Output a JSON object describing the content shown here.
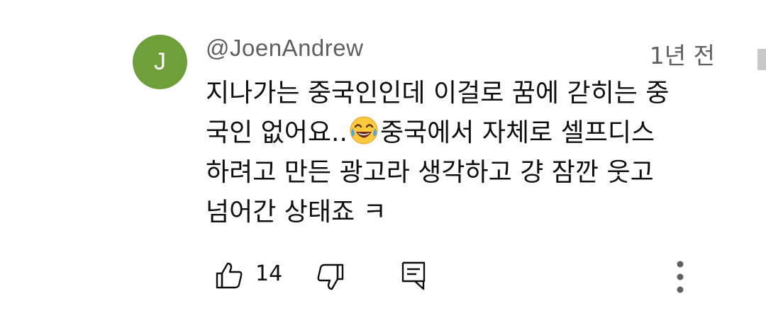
{
  "comment": {
    "avatar_letter": "J",
    "author": "@JoenAndrew",
    "time": "1년 전",
    "lines": [
      "지나가는 중국인인데 이걸로 꿈에 갇히는 중",
      "국인 없어요..",
      "중국에서 자체로 셀프디스",
      "하려고 만든 광고라 생각하고 걍 잠깐 웃고",
      "넘어간 상태죠 ㅋ"
    ],
    "emoji": "face-with-tears-of-joy",
    "like_count": "14"
  },
  "colors": {
    "avatar_bg": "#6f9f3a",
    "secondary_text": "#606060",
    "primary_text": "#0f0f0f"
  },
  "icons": [
    "thumbs-up-icon",
    "thumbs-down-icon",
    "reply-icon",
    "more-vert-icon"
  ]
}
